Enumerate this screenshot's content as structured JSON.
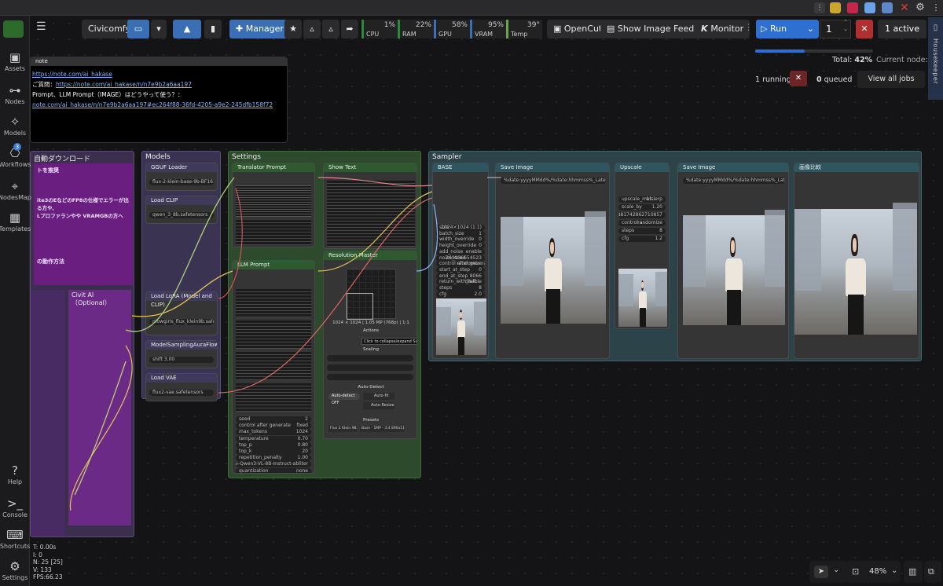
{
  "sidebar": {
    "items": [
      {
        "label": "Assets",
        "icon": "image-icon"
      },
      {
        "label": "Nodes",
        "icon": "plug-icon"
      },
      {
        "label": "Models",
        "icon": "sparkle-icon"
      },
      {
        "label": "Workflows",
        "icon": "workflow-icon",
        "badge": "3"
      },
      {
        "label": "NodesMap",
        "icon": "map-icon"
      },
      {
        "label": "Templates",
        "icon": "template-icon"
      },
      {
        "label": "Help",
        "icon": "help-icon"
      },
      {
        "label": "Console",
        "icon": "console-icon"
      },
      {
        "label": "Shortcuts",
        "icon": "keyboard-icon"
      },
      {
        "label": "Settings",
        "icon": "gear-icon"
      }
    ]
  },
  "topbar": {
    "civicomfy": "Civicomfy",
    "manager": "Manager",
    "opencut": "OpenCut",
    "show_image_feed": "Show Image Feed",
    "monitor": "Monitor",
    "stats": [
      {
        "label": "CPU",
        "value": "1%"
      },
      {
        "label": "RAM",
        "value": "22%"
      },
      {
        "label": "GPU",
        "value": "58%"
      },
      {
        "label": "VRAM",
        "value": "95%"
      },
      {
        "label": "Temp",
        "value": "39°"
      }
    ]
  },
  "run": {
    "run_label": "Run",
    "count": "1",
    "active": "1 active",
    "total_label": "Total:",
    "total_value": "42%",
    "progress": 0.42,
    "current_node_label": "Current node:",
    "running": "1 running",
    "queued_count": "0",
    "queued_label": "queued",
    "view_all": "View all jobs",
    "housekeeper": "Housekeeper"
  },
  "note": {
    "header": "note",
    "line1": "https://note.com/ai_hakase",
    "line2_label": "ご質問：",
    "line2_link": "https://note.com/ai_hakase/n/n7e9b2a6aa197",
    "line3": "Prompt、LLM Prompt（IMAGE）はどうやって使う？：",
    "line4": "note.com/ai_hakase/n/n7e9b2a6aa197#ec264f88-36fd-4205-a9e2-245dfb158f72"
  },
  "groups": {
    "download": "自動ダウンロード",
    "models": "Models",
    "settings": "Settings",
    "sampler": "Sampler",
    "civit": "Civit AI（Optional）"
  },
  "download_texts": [
    "トを推奨",
    "ite3のEなどのFP8の仕様でエラーが出る方や、",
    "Lプロファランやや VRAMGBの方へ",
    "の動作方法"
  ],
  "models_nodes": [
    {
      "title": "GGUF Loader",
      "id": "#168 gguf",
      "value": "flux-2-klein-base-9b-BF16.gguf"
    },
    {
      "title": "Load CLIP",
      "id": "#95",
      "value": "qwen_3_8b.safetensors"
    },
    {
      "title": "Load LoRA (Model and CLIP)",
      "id": "#244",
      "value": "nlowgirls_flux_klein9b.safetens"
    },
    {
      "title": "ModelSamplingAuraFlow",
      "id": "#291",
      "value": "shift 3.00"
    },
    {
      "title": "Load VAE",
      "id": "#100",
      "value": "flux2-vae.safetensors"
    }
  ],
  "settings_nodes": [
    {
      "title": "Translator Prompt",
      "id": "#169"
    },
    {
      "title": "Show Text",
      "id": "#273 Custom-Scripts"
    },
    {
      "title": "LLM Prompt",
      "id": "#272"
    },
    {
      "title": "Resolution Master",
      "id": "#271 Comfyui-Resolution-Master"
    }
  ],
  "resolution": {
    "size": "1024 × 1024 | 1.05 MP (768p) | 1:1",
    "tooltip": "Click to collapse/expand Scaling section",
    "actions": "Actions",
    "scaling": "Scaling",
    "auto_detect": "Auto-Detect",
    "presets": "Presets",
    "auto_detect_off": "Auto-detect OFF",
    "auto_fit": "Auto-fit",
    "auto_resize": "Auto-Resize",
    "preset_a": "Flux 2 Klein 9B",
    "preset_b": "Base - 1MP - 3:4 896x1152"
  },
  "llm_settings": [
    {
      "k": "seed",
      "v": "2"
    },
    {
      "k": "control after generate",
      "v": "fixed"
    },
    {
      "k": "max_tokens",
      "v": "1024"
    },
    {
      "k": "temperature",
      "v": "0.70"
    },
    {
      "k": "top_p",
      "v": "0.80"
    },
    {
      "k": "top_k",
      "v": "20"
    },
    {
      "k": "repetition_penalty",
      "v": "1.00"
    },
    {
      "k": "",
      "v": "Huihui-Qwen3-VL-8B-Instruct-abliter"
    },
    {
      "k": "quantization",
      "v": "none"
    }
  ],
  "sampler_nodes": [
    {
      "title": "BASE",
      "id": "#299"
    },
    {
      "title": "Save Image",
      "id": "#106"
    },
    {
      "title": "Upscale",
      "id": "#368"
    },
    {
      "title": "Save Image",
      "id": "#131"
    },
    {
      "title": "画像比較",
      "id": "#146 rgthree-comfy"
    }
  ],
  "sampler_base_rows": [
    {
      "k": "size",
      "v": "1024×1024 (1:1)"
    },
    {
      "k": "batch_size",
      "v": "1"
    },
    {
      "k": "width_override",
      "v": "0"
    },
    {
      "k": "height_override",
      "v": "0"
    },
    {
      "k": "add_noise",
      "v": "enable"
    },
    {
      "k": "noise_seed",
      "v": "269936654523"
    },
    {
      "k": "control after generate",
      "v": "randomize"
    },
    {
      "k": "start_at_step",
      "v": "0"
    },
    {
      "k": "end_at_step",
      "v": "8066"
    },
    {
      "k": "return_with_left...",
      "v": "disable"
    },
    {
      "k": "steps",
      "v": "8"
    },
    {
      "k": "cfg",
      "v": "2.0"
    }
  ],
  "upscale_rows": [
    {
      "k": "upscale_met...",
      "v": "bislerp"
    },
    {
      "k": "scale_by",
      "v": "1.20"
    },
    {
      "k": "",
      "v": "881742862710857"
    },
    {
      "k": "control a...",
      "v": "randomize"
    },
    {
      "k": "steps",
      "v": "8"
    },
    {
      "k": "cfg",
      "v": "1.2"
    }
  ],
  "filename": "%date:yyyyMMdd%/%date:hhmmss%_Latent",
  "debug": {
    "t": "T: 0.00s",
    "i": "I: 0",
    "n": "N: 25 [25]",
    "v": "V: 133",
    "fps": "FPS:66.23"
  },
  "zoom": "48%"
}
